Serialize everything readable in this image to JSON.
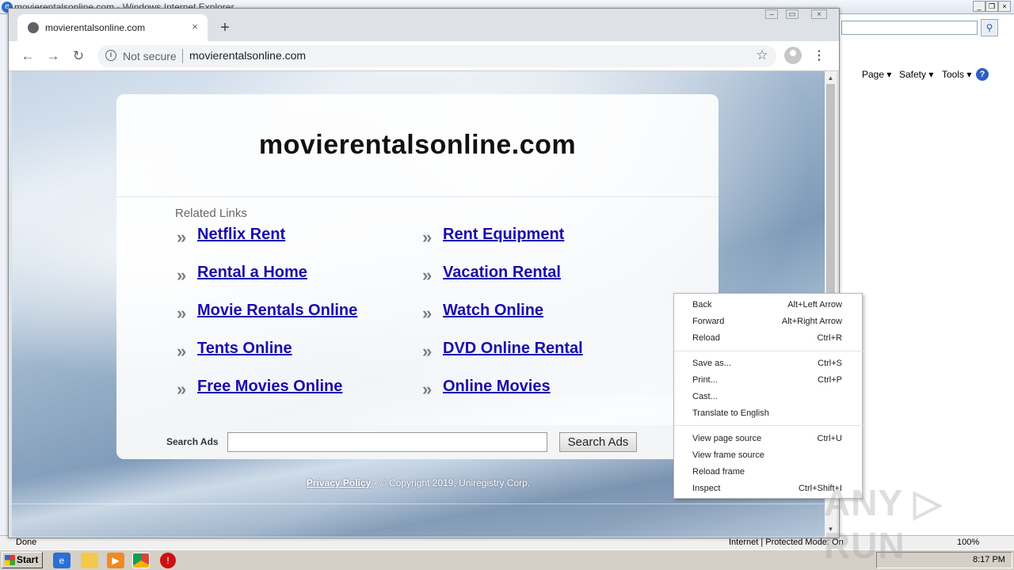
{
  "ie": {
    "title": "movierentalsonline.com - Windows Internet Explorer",
    "min": "_",
    "restore": "❐",
    "close": "×",
    "search_icon": "⚲",
    "menu": {
      "page": "Page ▾",
      "safety": "Safety ▾",
      "tools": "Tools ▾",
      "help": "?"
    },
    "status": {
      "done": "Done",
      "zone": "Internet | Protected Mode: On",
      "zoom": "100%"
    }
  },
  "taskbar": {
    "start": "Start",
    "clock": "8:17 PM"
  },
  "chrome": {
    "tab_title": "movierentalsonline.com",
    "tab_close": "×",
    "new_tab": "+",
    "back": "←",
    "forward": "→",
    "reload": "↻",
    "info": "i",
    "not_secure": "Not secure",
    "url": "movierentalsonline.com",
    "star": "☆",
    "menu": "⋮",
    "minimize": "–",
    "maximize": "▭",
    "close": "×"
  },
  "page": {
    "domain": "movierentalsonline.com",
    "related_label": "Related Links",
    "arrow": "»",
    "links_left": [
      "Netflix Rent",
      "Rental a Home",
      "Movie Rentals Online",
      "Tents Online",
      "Free Movies Online"
    ],
    "links_right": [
      "Rent Equipment",
      "Vacation Rental",
      "Watch Online",
      "DVD Online Rental",
      "Online Movies"
    ],
    "search_label": "Search Ads",
    "search_value": "",
    "search_button": "Search Ads",
    "privacy_policy": "Privacy Policy",
    "copyright": " - © Copyright 2019, Uniregistry Corp."
  },
  "context_menu": {
    "groups": [
      [
        {
          "label": "Back",
          "shortcut": "Alt+Left Arrow"
        },
        {
          "label": "Forward",
          "shortcut": "Alt+Right Arrow"
        },
        {
          "label": "Reload",
          "shortcut": "Ctrl+R"
        }
      ],
      [
        {
          "label": "Save as...",
          "shortcut": "Ctrl+S"
        },
        {
          "label": "Print...",
          "shortcut": "Ctrl+P"
        },
        {
          "label": "Cast...",
          "shortcut": ""
        },
        {
          "label": "Translate to English",
          "shortcut": ""
        }
      ],
      [
        {
          "label": "View page source",
          "shortcut": "Ctrl+U"
        },
        {
          "label": "View frame source",
          "shortcut": ""
        },
        {
          "label": "Reload frame",
          "shortcut": ""
        },
        {
          "label": "Inspect",
          "shortcut": "Ctrl+Shift+I"
        }
      ]
    ]
  },
  "watermark": "ANY ▷ RUN"
}
